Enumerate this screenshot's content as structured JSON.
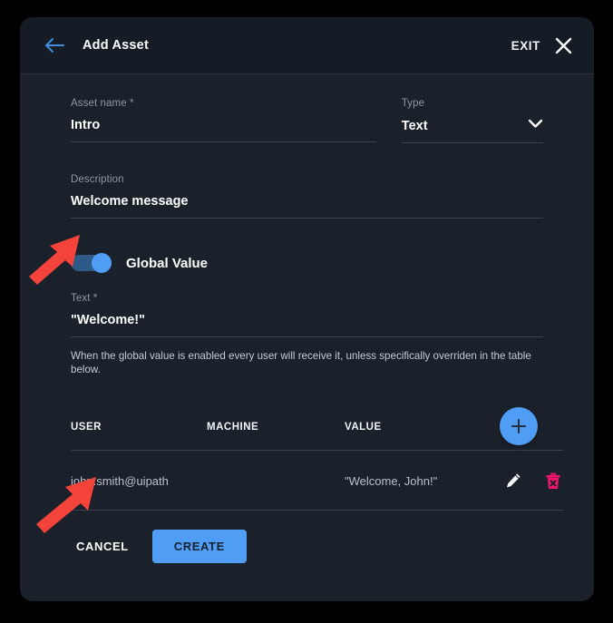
{
  "header": {
    "back_icon": "arrow-left-icon",
    "title": "Add Asset",
    "exit_label": "EXIT",
    "close_icon": "close-icon"
  },
  "form": {
    "asset_name": {
      "label": "Asset name *",
      "value": "Intro"
    },
    "type": {
      "label": "Type",
      "value": "Text",
      "chevron_icon": "chevron-down-icon"
    },
    "description": {
      "label": "Description",
      "value": "Welcome message"
    },
    "global_value": {
      "toggle_label": "Global Value",
      "enabled": true
    },
    "text": {
      "label": "Text *",
      "value": "\"Welcome!\""
    },
    "helper_text": "When the global value is enabled every user will receive it, unless specifically overriden in the table below."
  },
  "table": {
    "add_button_icon": "plus-icon",
    "columns": [
      "USER",
      "MACHINE",
      "VALUE",
      ""
    ],
    "rows": [
      {
        "user": "john.smith@uipath",
        "machine": "",
        "value": "\"Welcome, John!\"",
        "edit_icon": "pencil-icon",
        "delete_icon": "trash-delete-icon"
      }
    ]
  },
  "footer": {
    "cancel_label": "CANCEL",
    "create_label": "CREATE"
  },
  "colors": {
    "page_background": "#000000",
    "dialog_background": "#1b212a",
    "header_background": "#161c25",
    "accent_blue": "#4f9df5",
    "toggle_track": "#2d5a86",
    "delete_pink": "#f5166b",
    "annotation_red": "#f4433b",
    "divider": "#39414c",
    "label_grey": "#8d98a6"
  },
  "annotations": [
    {
      "name": "arrow-pointing-at-global-value-toggle",
      "color": "#f4433b"
    },
    {
      "name": "arrow-pointing-at-user-row",
      "color": "#f4433b"
    }
  ]
}
